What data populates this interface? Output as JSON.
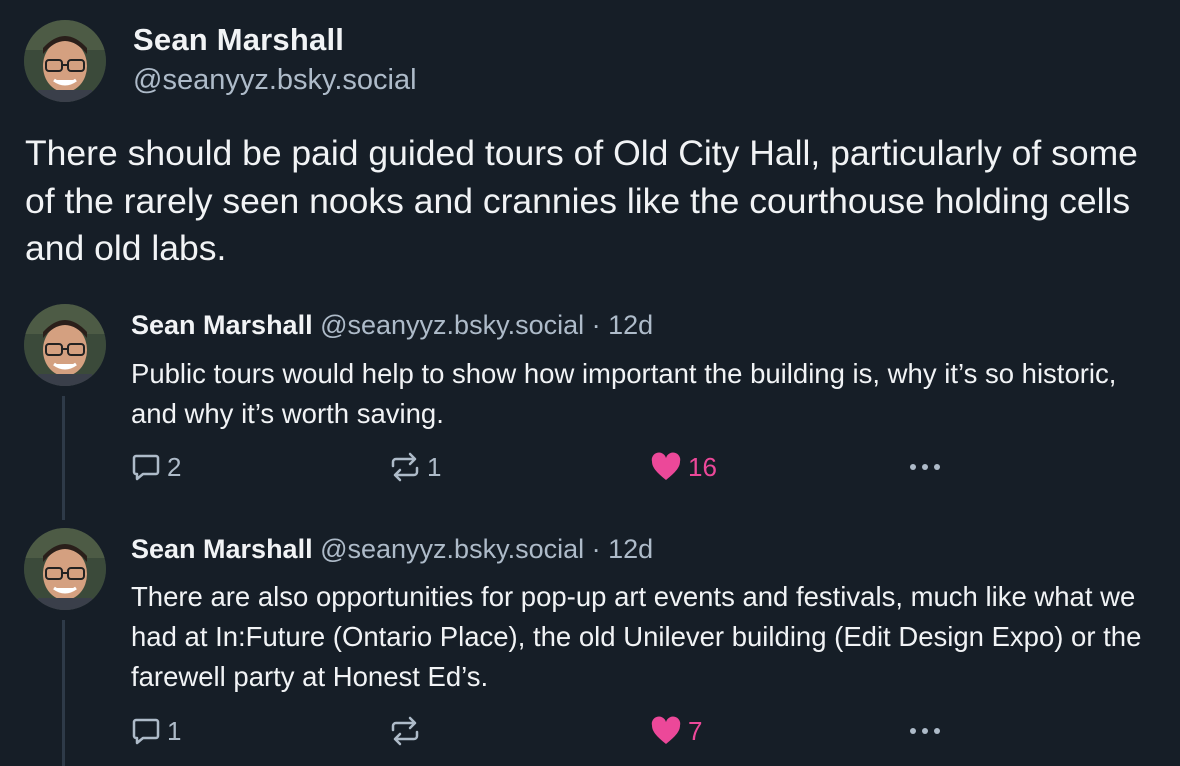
{
  "main_post": {
    "author": "Sean Marshall",
    "handle": "@seanyyz.bsky.social",
    "text": "There should be paid guided tours of Old City Hall, particularly of some of the rarely seen nooks and crannies like the courthouse holding cells and old labs."
  },
  "replies": [
    {
      "author": "Sean Marshall",
      "handle": "@seanyyz.bsky.social",
      "separator": "·",
      "time": "12d",
      "text": "Public tours would help to show how important the building is, why it’s so historic, and why it’s worth saving.",
      "reply_count": "2",
      "repost_count": "1",
      "like_count": "16"
    },
    {
      "author": "Sean Marshall",
      "handle": "@seanyyz.bsky.social",
      "separator": "·",
      "time": "12d",
      "text": "There are also opportunities for pop-up art events and festivals, much like what we had at In:Future (Ontario Place), the old Unilever building (Edit Design Expo) or the farewell party at Honest Ed’s.",
      "reply_count": "1",
      "repost_count": "",
      "like_count": "7"
    }
  ],
  "icons": {
    "reply": "speech-bubble-icon",
    "repost": "repost-arrows-icon",
    "like": "heart-icon",
    "more": "more-dots-icon"
  },
  "colors": {
    "background": "#161e27",
    "text": "#f1f3f5",
    "muted": "#aebbc9",
    "like": "#ec4899"
  }
}
